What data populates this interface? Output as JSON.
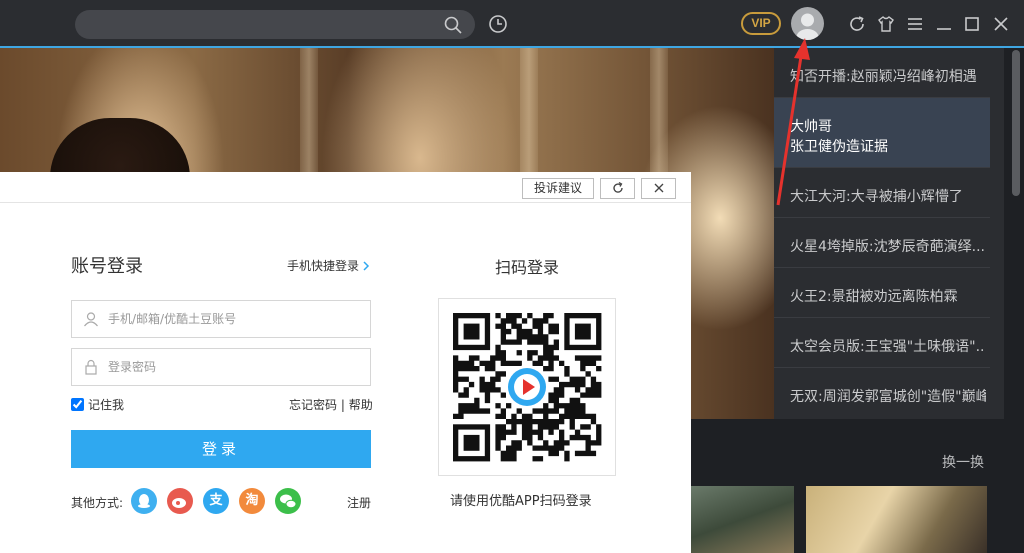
{
  "titlebar": {
    "search_placeholder": "",
    "vip_label": "VIP"
  },
  "side_list": {
    "items": [
      {
        "text": "知否开播:赵丽颖冯绍峰初相遇"
      },
      {
        "line1": "大帅哥",
        "line2": "张卫健伪造证据"
      },
      {
        "text": "大江大河:大寻被捕小辉懵了"
      },
      {
        "text": "火星4垮掉版:沈梦辰奇葩演绎..."
      },
      {
        "text": "火王2:景甜被劝远离陈柏霖"
      },
      {
        "text": "太空会员版:王宝强\"土味俄语\"..."
      },
      {
        "text": "无双:周润发郭富城创\"造假\"巅峰"
      }
    ],
    "refresh_label": "换一换"
  },
  "dialog": {
    "complain_label": "投诉建议",
    "account_title": "账号登录",
    "mobile_login_label": "手机快捷登录",
    "account_placeholder": "手机/邮箱/优酷土豆账号",
    "password_placeholder": "登录密码",
    "remember_label": "记住我",
    "forgot_label": "忘记密码",
    "separator": "|",
    "help_label": "帮助",
    "login_label": "登录",
    "other_label": "其他方式:",
    "social": [
      {
        "name": "qq",
        "glyph": "",
        "color": "#3fb0f0"
      },
      {
        "name": "weibo",
        "glyph": "",
        "color": "#e85a4f"
      },
      {
        "name": "alipay",
        "glyph": "支",
        "color": "#2fa8f0"
      },
      {
        "name": "taobao",
        "glyph": "淘",
        "color": "#f28a3c"
      },
      {
        "name": "wechat",
        "glyph": "",
        "color": "#3cbf4a"
      }
    ],
    "register_label": "注册",
    "qr_title": "扫码登录",
    "qr_hint": "请使用优酷APP扫码登录"
  },
  "colors": {
    "accent": "#2fa8f0",
    "titlebar_bg": "#2b2d31",
    "vip": "#d3a544"
  }
}
